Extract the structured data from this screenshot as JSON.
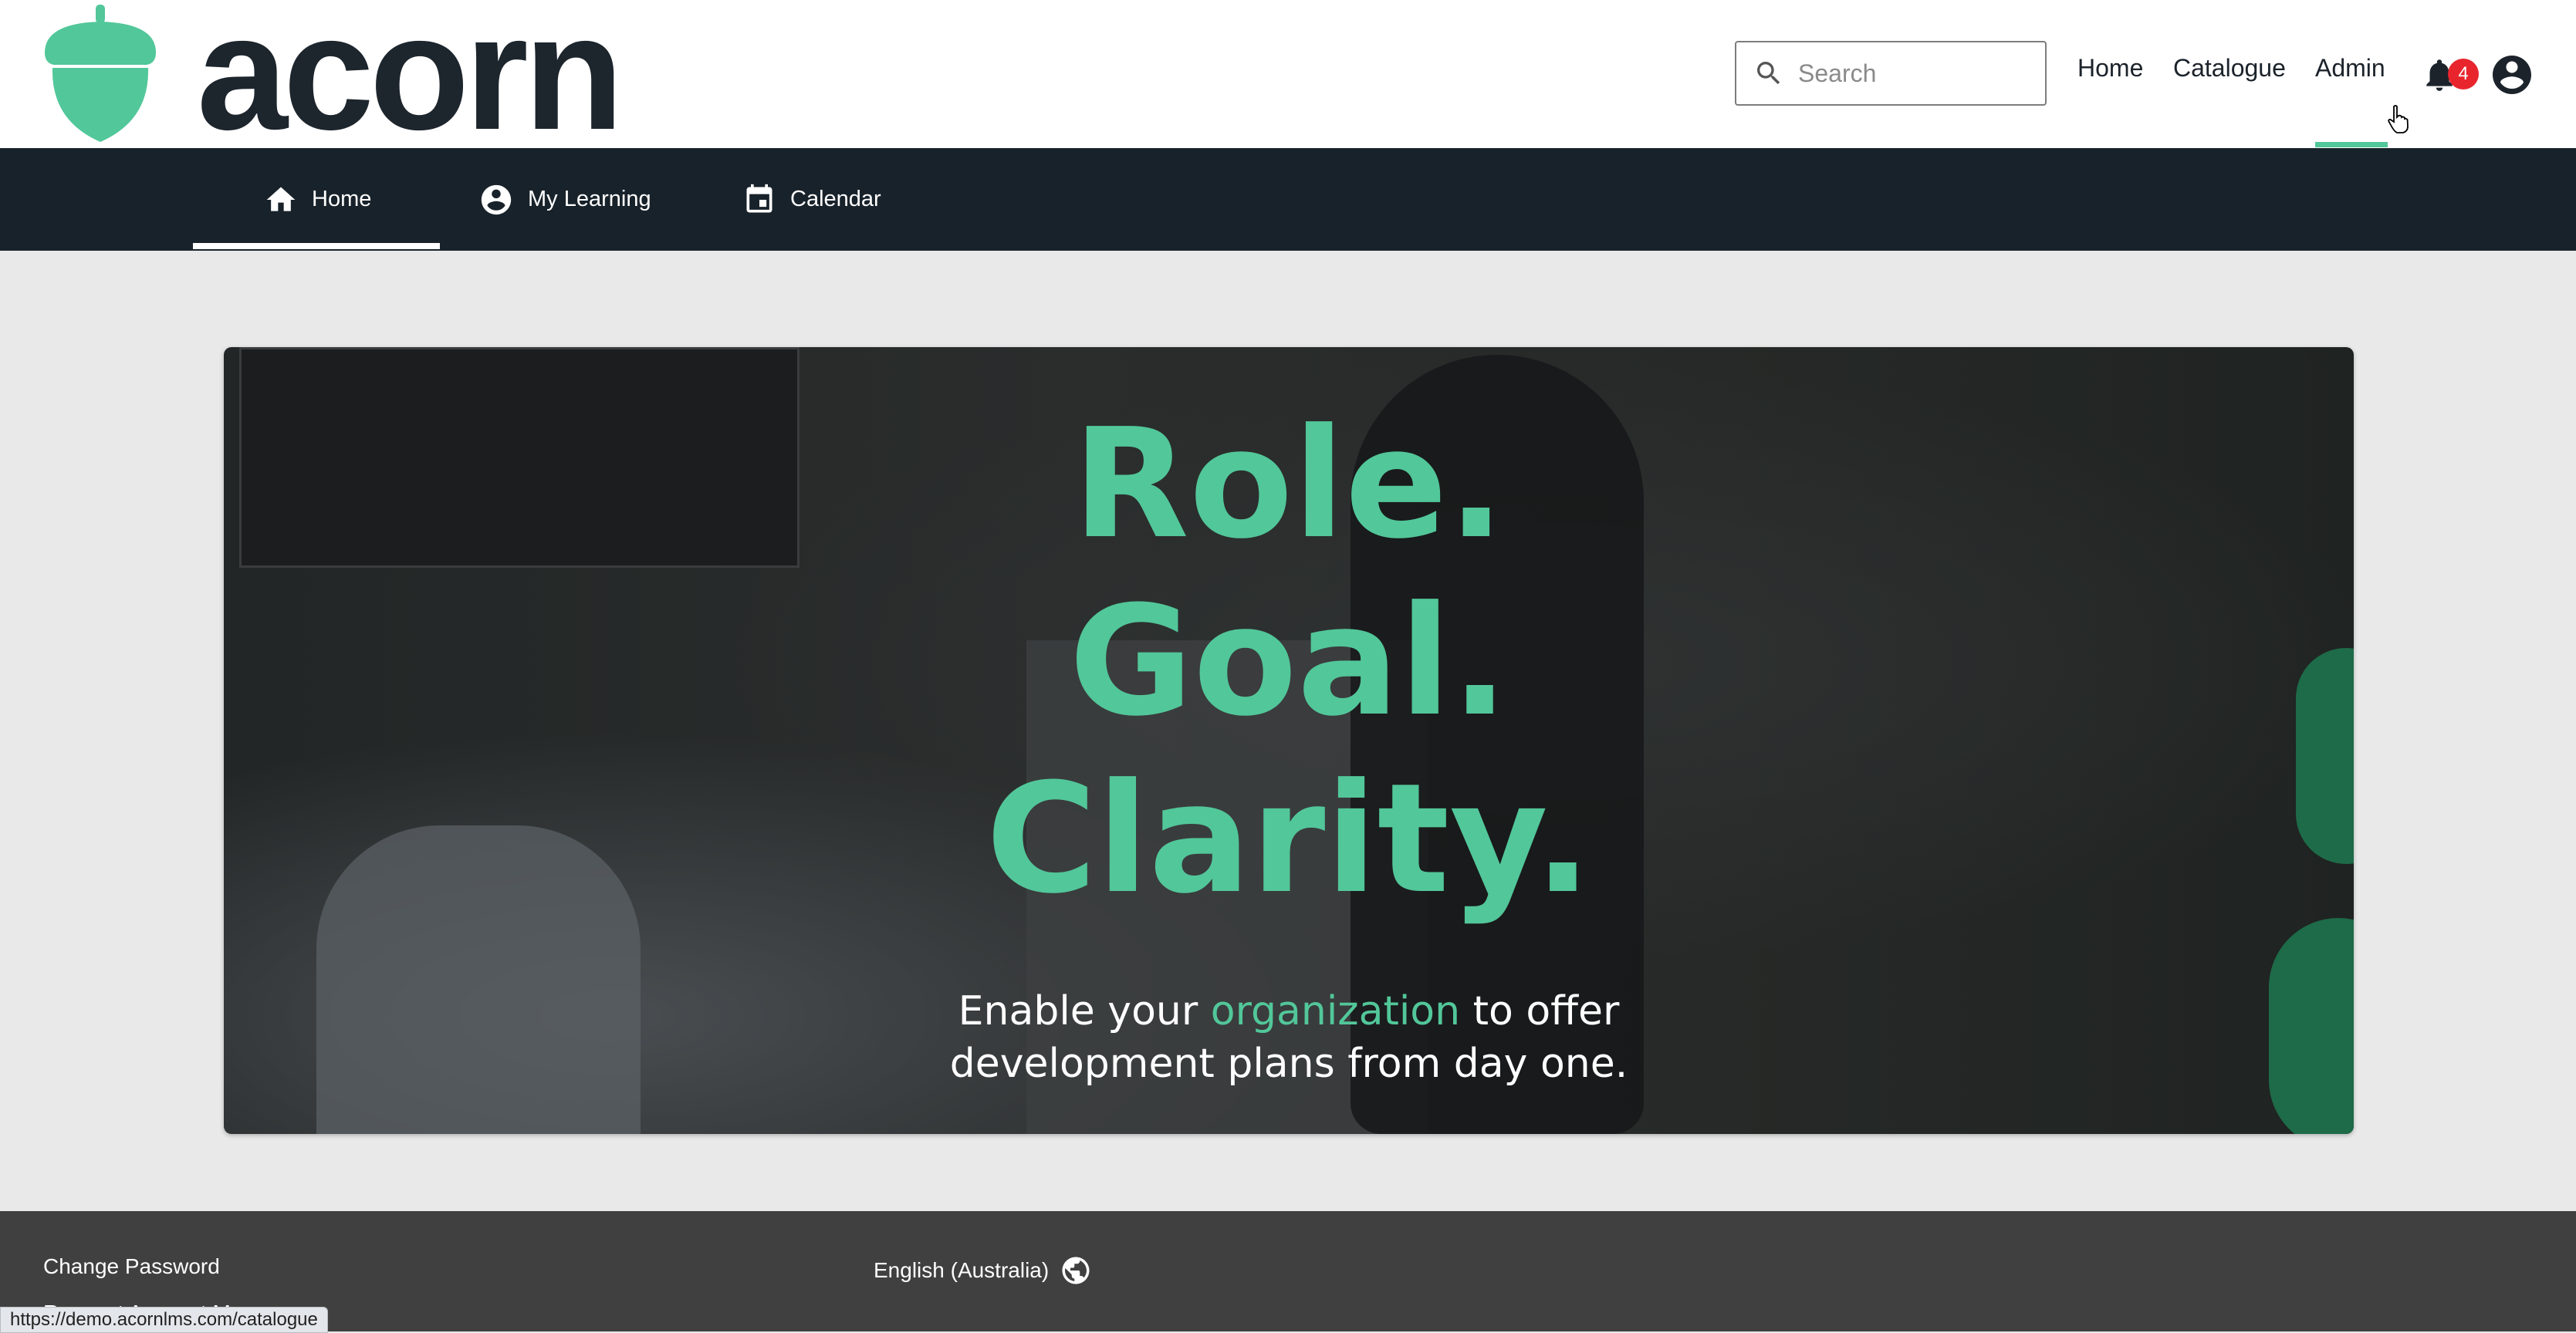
{
  "brand": {
    "name": "acorn",
    "color": "#52c79a",
    "logo_icon": "acorn-icon"
  },
  "search": {
    "placeholder": "Search",
    "value": "",
    "icon": "search-icon"
  },
  "top_nav": {
    "items": [
      {
        "label": "Home"
      },
      {
        "label": "Catalogue"
      },
      {
        "label": "Admin",
        "active": true
      }
    ],
    "notifications": {
      "icon": "bell-icon",
      "count": "4",
      "badge_color": "#e8252d"
    },
    "account": {
      "icon": "account-circle-icon"
    }
  },
  "sub_nav": {
    "background": "#18222a",
    "tabs": [
      {
        "label": "Home",
        "icon": "home-icon",
        "active": true
      },
      {
        "label": "My Learning",
        "icon": "account-circle-icon",
        "active": false
      },
      {
        "label": "Calendar",
        "icon": "calendar-icon",
        "active": false
      }
    ]
  },
  "hero": {
    "headline_lines": [
      "Role.",
      "Goal.",
      "Clarity."
    ],
    "sub_line1_prefix": "Enable your ",
    "sub_line1_accent": "organization",
    "sub_line1_suffix": " to offer",
    "sub_line2": "development plans from day one."
  },
  "footer": {
    "change_password": "Change Password",
    "partial_link": "Request Account Merge",
    "language": "English (Australia)",
    "language_icon": "globe-icon"
  },
  "status_bar": {
    "url": "https://demo.acornlms.com/catalogue"
  }
}
